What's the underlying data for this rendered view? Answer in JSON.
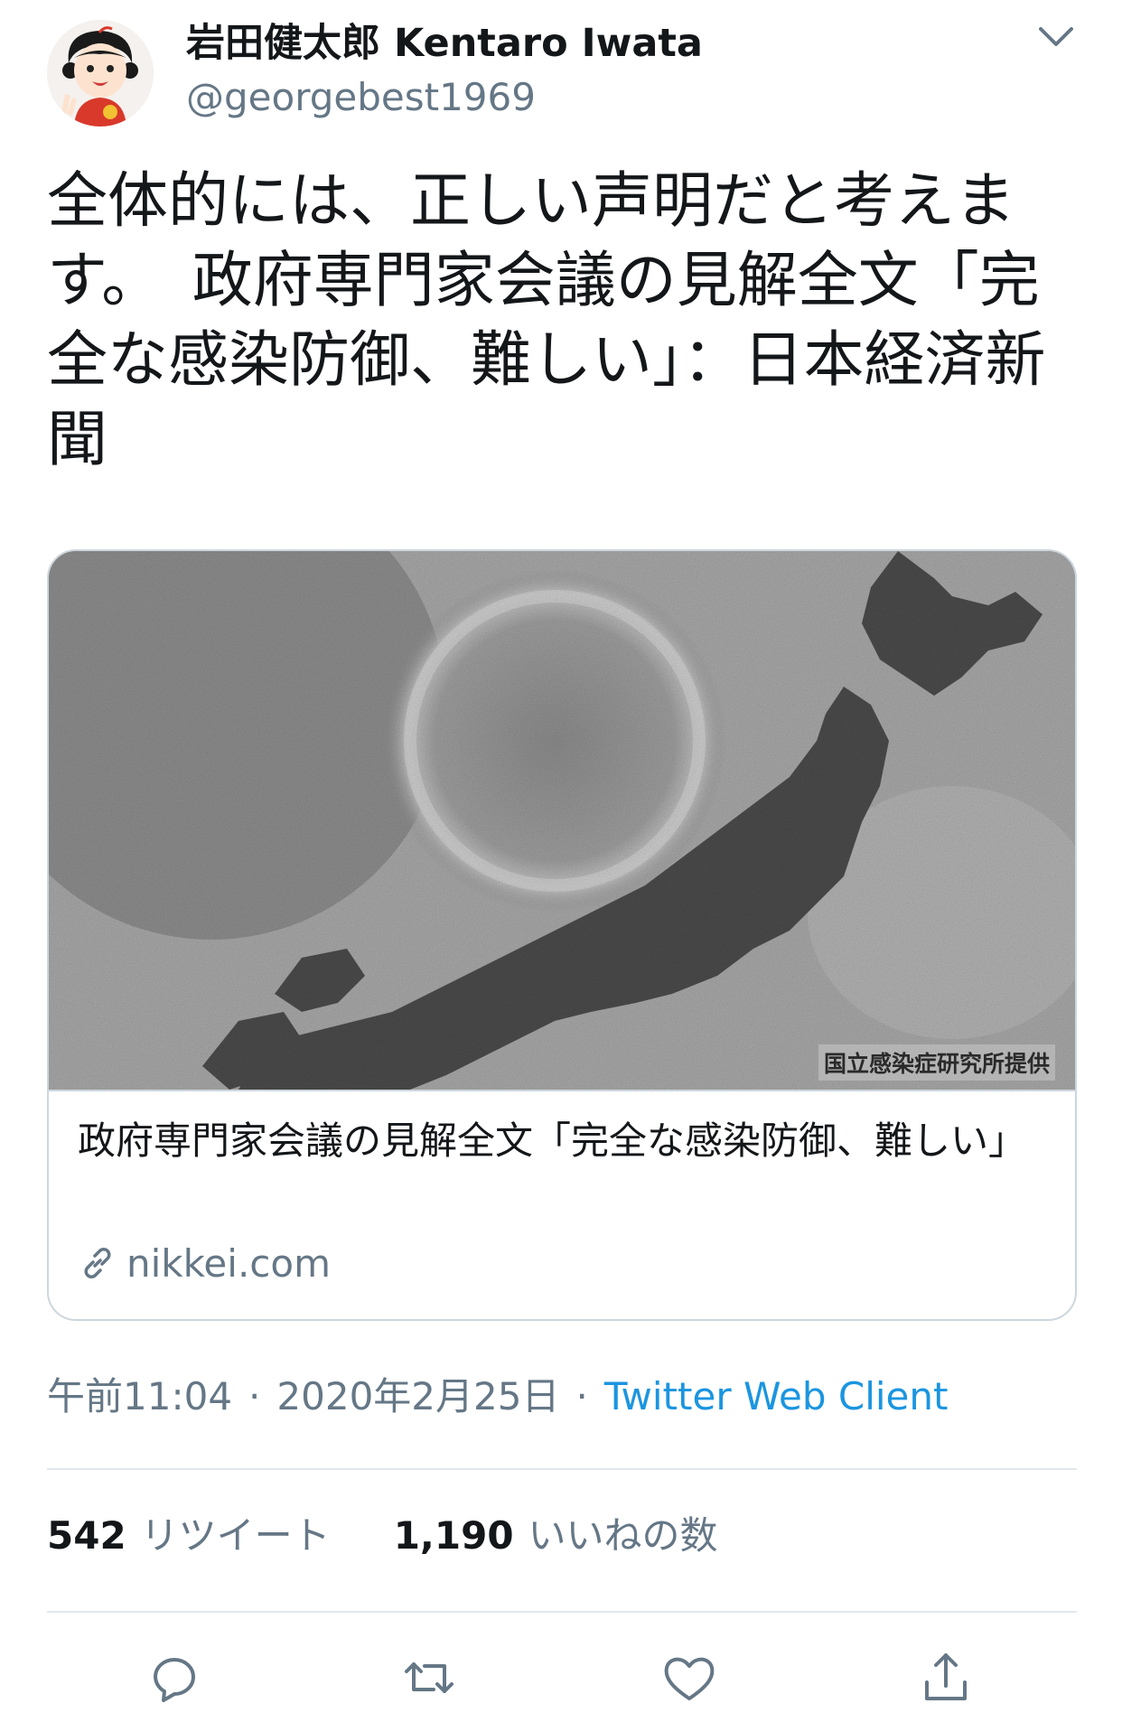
{
  "user": {
    "display_name": "岩田健太郎 Kentaro Iwata",
    "handle": "@georgebest1969"
  },
  "tweet": {
    "text": "全体的には、正しい声明だと考えます。　政府専門家会議の見解全文「完全な感染防御、難しい」：日本経済新聞"
  },
  "card": {
    "image_credit": "国立感染症研究所提供",
    "title": "政府専門家会議の見解全文「完全な感染防御、難しい」",
    "domain": "nikkei.com"
  },
  "meta": {
    "time": "午前11:04",
    "separator": "·",
    "date": "2020年2月25日",
    "source": "Twitter Web Client",
    "source_color": "#1b95e0"
  },
  "stats": {
    "retweets_count": "542",
    "retweets_label": "リツイート",
    "likes_count": "1,190",
    "likes_label": "いいねの数"
  },
  "icons": {
    "more": "chevron-down-icon",
    "link": "link-icon",
    "reply": "reply-icon",
    "retweet": "retweet-icon",
    "like": "heart-icon",
    "share": "share-icon"
  }
}
